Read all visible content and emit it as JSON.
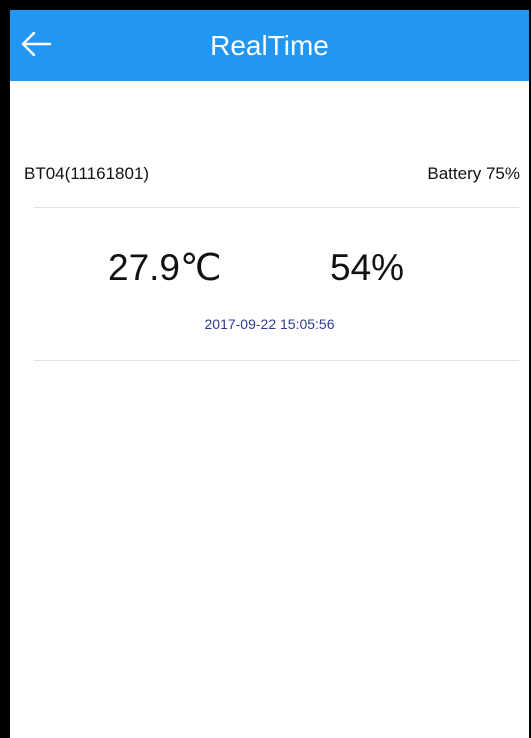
{
  "appbar": {
    "title": "RealTime",
    "back_icon": "back-arrow-icon",
    "color": "#2196f3"
  },
  "device": {
    "name": "BT04(11161801)",
    "battery": "Battery 75%"
  },
  "reading": {
    "temperature": "27.9℃",
    "humidity": "54%",
    "timestamp": "2017-09-22 15:05:56",
    "timestamp_color": "#2e3b8f"
  }
}
